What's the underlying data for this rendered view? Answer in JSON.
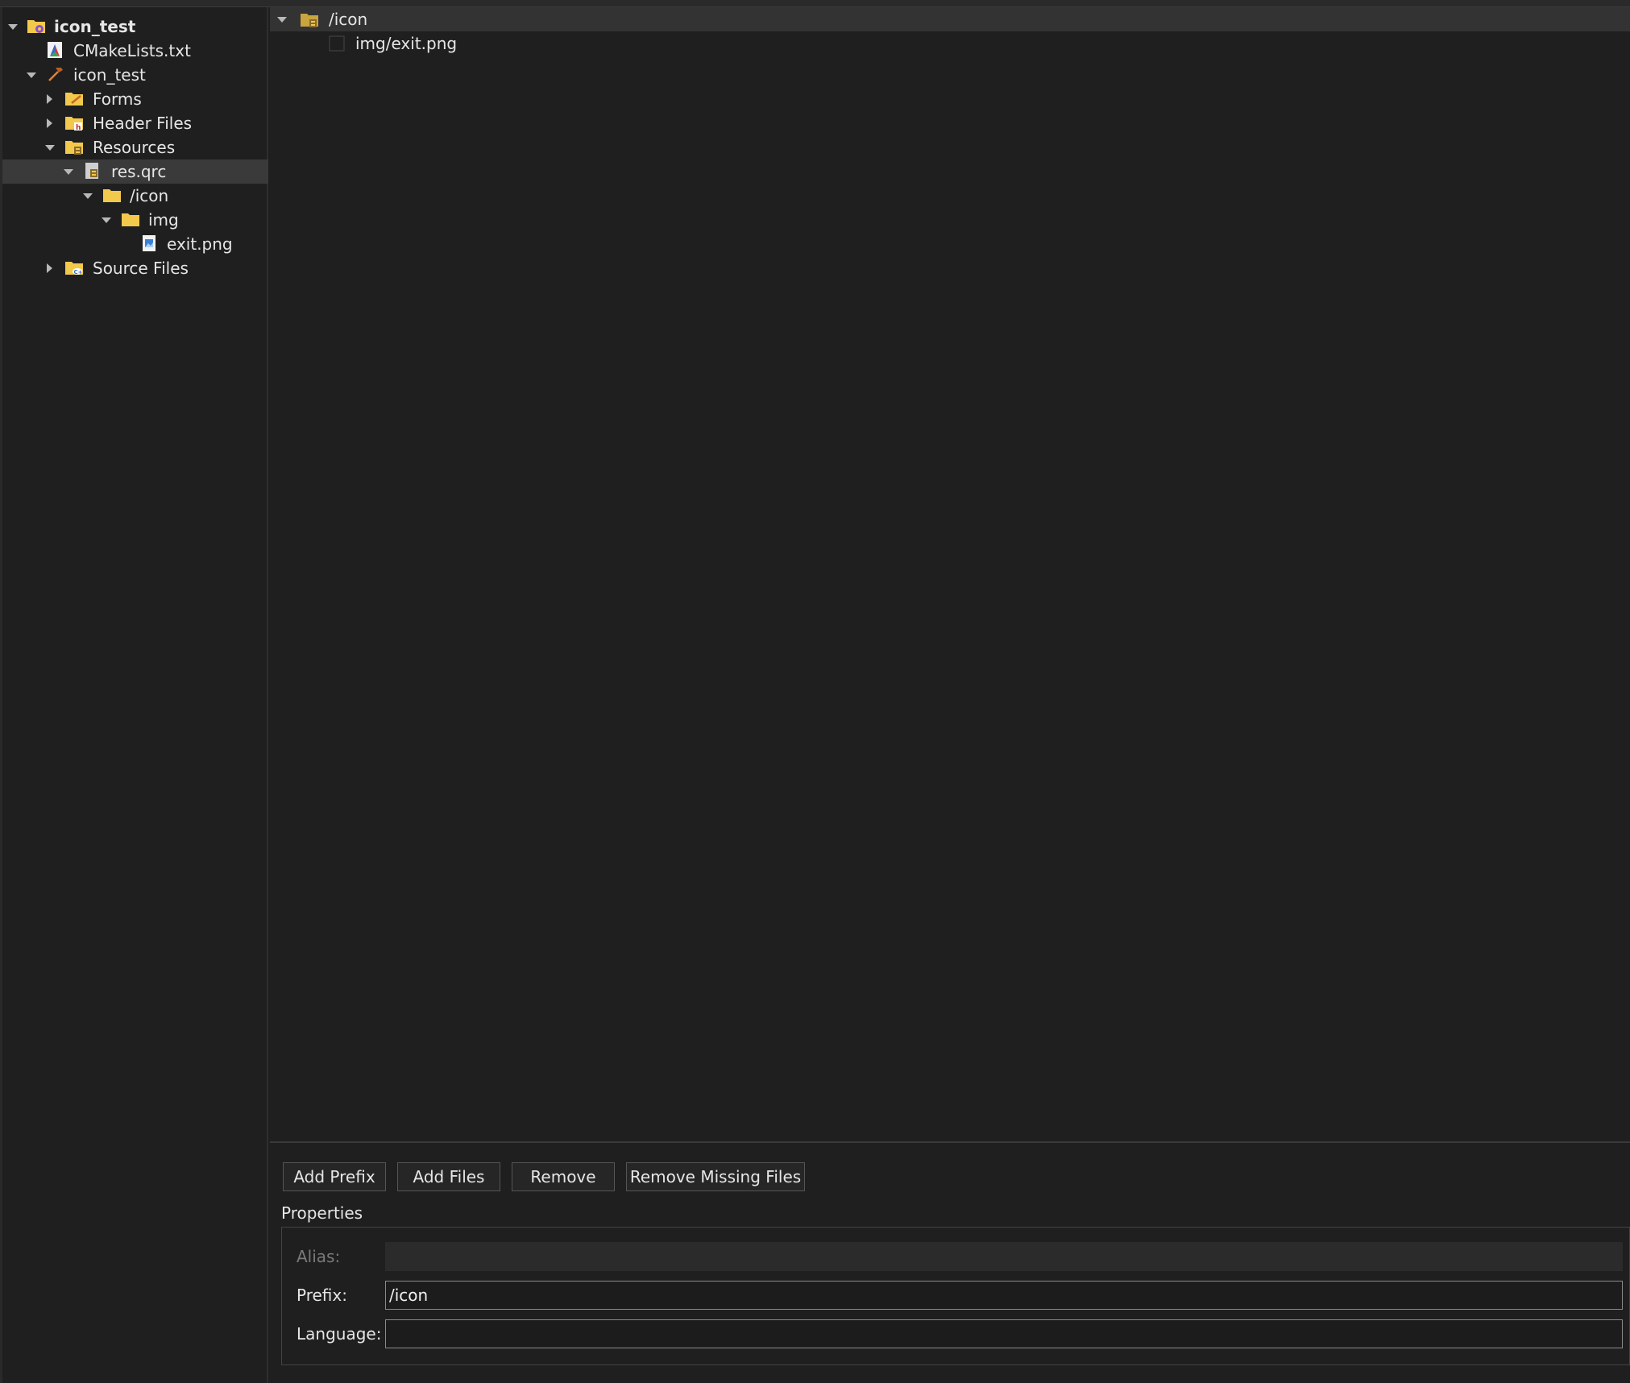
{
  "project_tree": {
    "items": [
      {
        "label": "icon_test"
      },
      {
        "label": "CMakeLists.txt"
      },
      {
        "label": "icon_test"
      },
      {
        "label": "Forms"
      },
      {
        "label": "Header Files"
      },
      {
        "label": "Resources"
      },
      {
        "label": "res.qrc"
      },
      {
        "label": "/icon"
      },
      {
        "label": "img"
      },
      {
        "label": "exit.png"
      },
      {
        "label": "Source Files"
      }
    ]
  },
  "resource_tree": {
    "prefix": "/icon",
    "file": "img/exit.png"
  },
  "toolbar": {
    "add_prefix": "Add Prefix",
    "add_files": "Add Files",
    "remove": "Remove",
    "remove_missing": "Remove Missing Files"
  },
  "properties": {
    "title": "Properties",
    "alias_label": "Alias:",
    "alias_value": "",
    "prefix_label": "Prefix:",
    "prefix_value": "/icon",
    "language_label": "Language:",
    "language_value": ""
  },
  "colors": {
    "background": "#1f1f1f",
    "selection": "#3a3a3a",
    "folder": "#f2c94c"
  }
}
